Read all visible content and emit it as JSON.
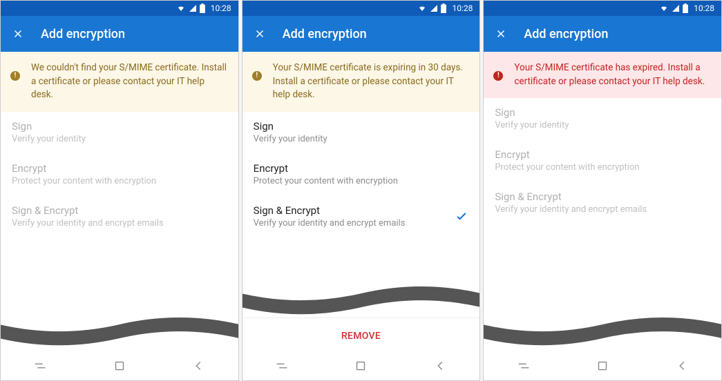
{
  "status": {
    "time": "10:28"
  },
  "header": {
    "title": "Add encryption"
  },
  "banners": {
    "notfound": "We couldn't find your S/MIME certificate. Install a certificate or please contact your IT help desk.",
    "expiring": "Your S/MIME certificate is expiring in 30 days. Install a certificate or please contact your IT help desk.",
    "expired": "Your S/MIME certificate has expired. Install a certificate or please contact your IT help desk."
  },
  "options": {
    "sign": {
      "title": "Sign",
      "sub": "Verify your identity"
    },
    "encrypt": {
      "title": "Encrypt",
      "sub": "Protect your content with encryption"
    },
    "both": {
      "title": "Sign & Encrypt",
      "sub": "Verify your identity and encrypt emails"
    }
  },
  "buttons": {
    "remove": "REMOVE"
  },
  "screens": [
    {
      "banner": "notfound",
      "bannerClass": "banner-warn",
      "disabled": true,
      "selected": null,
      "remove": false
    },
    {
      "banner": "expiring",
      "bannerClass": "banner-warn",
      "disabled": false,
      "selected": "both",
      "remove": true
    },
    {
      "banner": "expired",
      "bannerClass": "banner-error",
      "disabled": true,
      "selected": null,
      "remove": false
    }
  ]
}
